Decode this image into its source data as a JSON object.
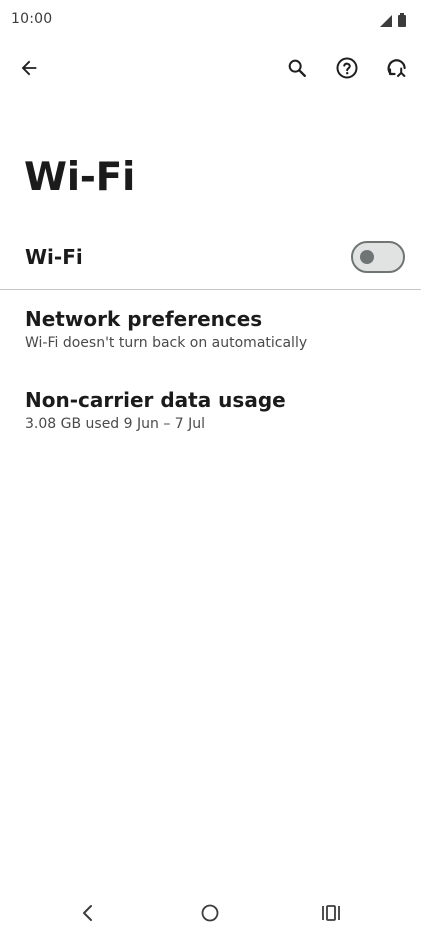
{
  "status_bar": {
    "time": "10:00",
    "icons": [
      "signal-icon",
      "battery-icon"
    ]
  },
  "toolbar": {
    "icons": [
      "back-arrow-icon",
      "search-icon",
      "help-icon",
      "refresh-icon"
    ]
  },
  "page": {
    "title": "Wi-Fi"
  },
  "wifi_toggle": {
    "label": "Wi-Fi",
    "enabled": false
  },
  "preferences": [
    {
      "title": "Network preferences",
      "summary": "Wi-Fi doesn't turn back on automatically"
    },
    {
      "title": "Non-carrier data usage",
      "summary": "3.08 GB used 9 Jun – 7 Jul"
    }
  ],
  "nav_bar": {
    "icons": [
      "nav-back-icon",
      "nav-home-icon",
      "nav-recents-icon"
    ]
  },
  "colors": {
    "background": "#ffffff",
    "text_primary": "#1b1b1b",
    "text_secondary": "#4a4a4a",
    "toggle_outline": "#6f7474",
    "toggle_track": "#e1e3e3",
    "divider": "#c4c7c7"
  }
}
